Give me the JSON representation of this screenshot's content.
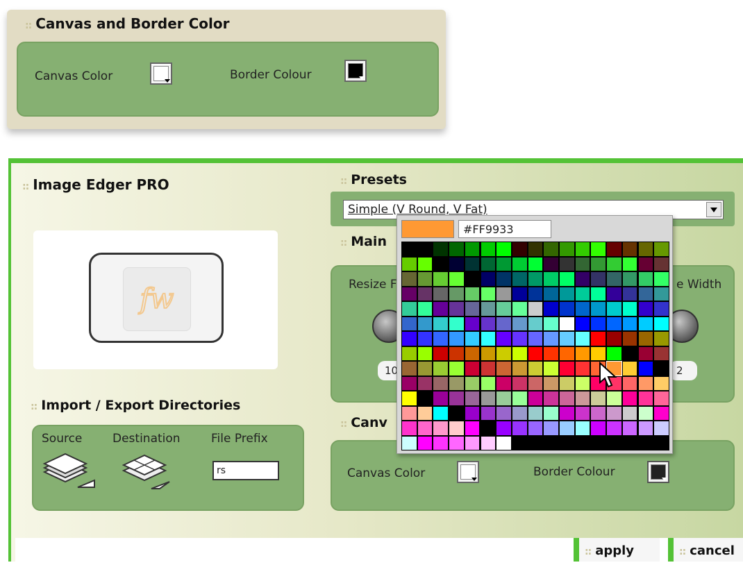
{
  "top_panel": {
    "title": "Canvas and Border Color",
    "canvas_color_label": "Canvas Color",
    "border_colour_label": "Border Colour",
    "canvas_color_value": "#ffffff",
    "border_color_value": "#000000"
  },
  "main_panel": {
    "title": "Image Edger PRO",
    "presets": {
      "title": "Presets",
      "selected": "Simple (V Round, V Fat)"
    },
    "main_section_title": "Main",
    "resize_label": "Resize F",
    "width_label": "e Width",
    "resize_value": "10",
    "width_value": "2",
    "import_export": {
      "title": "Import / Export Directories",
      "source_label": "Source",
      "destination_label": "Destination",
      "file_prefix_label": "File Prefix",
      "file_prefix_value": "rs"
    },
    "canvas_section": {
      "title": "Canv",
      "canvas_color_label": "Canvas Color",
      "border_colour_label": "Border Colour",
      "canvas_color_value": "#ffffff",
      "border_color_value": "#222222"
    },
    "preview_logo": "fw-logo-icon"
  },
  "color_picker": {
    "hex_value": "#FF9933",
    "preview_color": "#ff9933",
    "grid": [
      [
        "#000000",
        "#000000",
        "#003300",
        "#006600",
        "#009900",
        "#00cc00",
        "#00ff00",
        "#330000",
        "#333300",
        "#336600",
        "#339900",
        "#33cc00",
        "#33ff00",
        "#660000",
        "#663300",
        "#666600",
        "#669900"
      ],
      [
        "#66cc00",
        "#66ff00",
        "#000000",
        "#000033",
        "#003333",
        "#006633",
        "#009933",
        "#00cc33",
        "#00ff33",
        "#330033",
        "#333333",
        "#336633",
        "#339933",
        "#33cc33",
        "#33ff33",
        "#660033",
        "#663333"
      ],
      [
        "#666633",
        "#669933",
        "#66cc33",
        "#66ff33",
        "#000000",
        "#000066",
        "#003366",
        "#006666",
        "#009966",
        "#00cc66",
        "#00ff66",
        "#330066",
        "#333366",
        "#336666",
        "#339966",
        "#33cc66",
        "#33ff66"
      ],
      [
        "#660066",
        "#663366",
        "#666666",
        "#669966",
        "#66cc66",
        "#66ff66",
        "#999999",
        "#000099",
        "#003399",
        "#006699",
        "#009999",
        "#00cc99",
        "#00ff99",
        "#330099",
        "#333399",
        "#336699",
        "#339999"
      ],
      [
        "#33cc99",
        "#33ff99",
        "#660099",
        "#663399",
        "#666699",
        "#669999",
        "#66cc99",
        "#66ff99",
        "#cccccc",
        "#0000cc",
        "#0033cc",
        "#0066cc",
        "#0099cc",
        "#00cccc",
        "#00ffcc",
        "#3300cc",
        "#3333cc"
      ],
      [
        "#3366cc",
        "#3399cc",
        "#33cccc",
        "#33ffcc",
        "#6600cc",
        "#6633cc",
        "#6666cc",
        "#6699cc",
        "#66cccc",
        "#66ffcc",
        "#ffffff",
        "#0000ff",
        "#0033ff",
        "#0066ff",
        "#0099ff",
        "#00ccff",
        "#00ffff"
      ],
      [
        "#3300ff",
        "#3333ff",
        "#3366ff",
        "#3399ff",
        "#33ccff",
        "#33ffff",
        "#6600ff",
        "#6633ff",
        "#6666ff",
        "#6699ff",
        "#66ccff",
        "#66ffff",
        "#ff0000",
        "#990000",
        "#993300",
        "#996600",
        "#999900"
      ],
      [
        "#99cc00",
        "#99ff00",
        "#cc0000",
        "#cc3300",
        "#cc6600",
        "#cc9900",
        "#cccc00",
        "#ccff00",
        "#ff0000",
        "#ff3300",
        "#ff6600",
        "#ff9900",
        "#ffcc00",
        "#00ff00",
        "#000000",
        "#990033",
        "#993333"
      ],
      [
        "#996633",
        "#999933",
        "#99cc33",
        "#99ff33",
        "#cc0033",
        "#cc3333",
        "#cc6633",
        "#cc9933",
        "#cccc33",
        "#ccff33",
        "#ff0033",
        "#ff3333",
        "#ff6633",
        "#ff9933",
        "#ffcc33",
        "#0000ff",
        "#000000"
      ],
      [
        "#990066",
        "#993366",
        "#996666",
        "#999966",
        "#99cc66",
        "#99ff66",
        "#cc0066",
        "#cc3366",
        "#cc6666",
        "#cc9966",
        "#cccc66",
        "#ccff66",
        "#ff0066",
        "#ff3366",
        "#ff6666",
        "#ff9966",
        "#ffcc66"
      ],
      [
        "#ffff00",
        "#000000",
        "#990099",
        "#993399",
        "#996699",
        "#999999",
        "#99cc99",
        "#99ff99",
        "#cc0099",
        "#cc3399",
        "#cc6699",
        "#cc9999",
        "#cccc99",
        "#ccff99",
        "#ff0099",
        "#ff3399",
        "#ff6699"
      ],
      [
        "#ff9999",
        "#ffcc99",
        "#00ffff",
        "#000000",
        "#9900cc",
        "#9933cc",
        "#9966cc",
        "#9999cc",
        "#99cccc",
        "#99ffcc",
        "#cc00cc",
        "#cc33cc",
        "#cc66cc",
        "#cc99cc",
        "#cccccc",
        "#ccffcc",
        "#ff00cc"
      ],
      [
        "#ff33cc",
        "#ff66cc",
        "#ff99cc",
        "#ffcccc",
        "#ff00ff",
        "#000000",
        "#9900ff",
        "#9933ff",
        "#9966ff",
        "#9999ff",
        "#99ccff",
        "#99ffff",
        "#cc00ff",
        "#cc33ff",
        "#cc66ff",
        "#cc99ff",
        "#ccccff"
      ],
      [
        "#ccffff",
        "#ff00ff",
        "#ff33ff",
        "#ff66ff",
        "#ff99ff",
        "#ffccff",
        "#ffffff",
        "#000000",
        "#000000",
        "#000000",
        "#000000",
        "#000000",
        "#000000",
        "#000000",
        "#000000",
        "#000000",
        "#000000"
      ]
    ]
  },
  "buttons": {
    "apply_label": "apply",
    "cancel_label": "cancel"
  }
}
